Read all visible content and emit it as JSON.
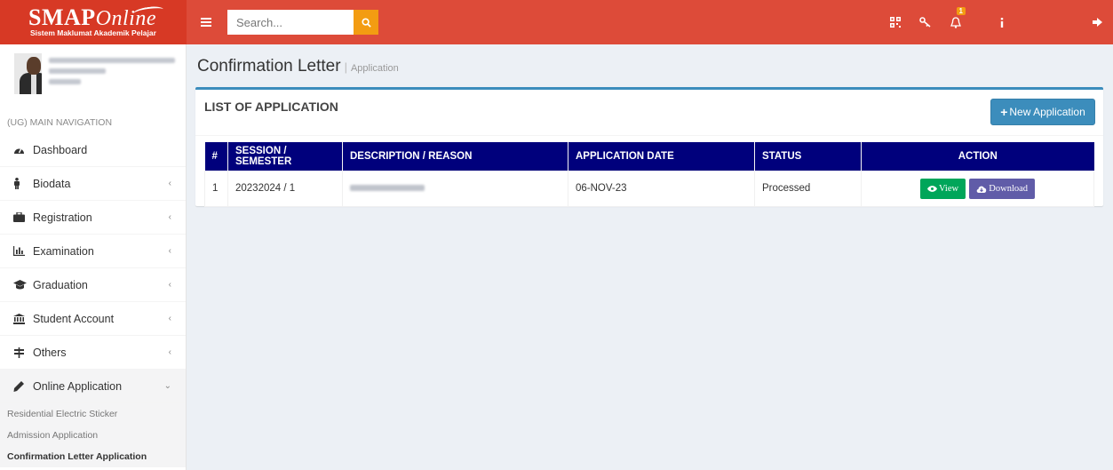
{
  "header": {
    "logo_text": "SMAP",
    "logo_script": "Online",
    "logo_subtitle": "Sistem Maklumat Akademik Pelajar",
    "search_placeholder": "Search...",
    "notification_count": "1"
  },
  "sidebar": {
    "nav_header": "(UG) MAIN NAVIGATION",
    "items": [
      {
        "label": "Dashboard",
        "icon": "dashboard-icon"
      },
      {
        "label": "Biodata",
        "icon": "male-icon"
      },
      {
        "label": "Registration",
        "icon": "briefcase-icon"
      },
      {
        "label": "Examination",
        "icon": "bar-chart-icon"
      },
      {
        "label": "Graduation",
        "icon": "graduation-cap-icon"
      },
      {
        "label": "Student Account",
        "icon": "bank-icon"
      },
      {
        "label": "Others",
        "icon": "signpost-icon"
      },
      {
        "label": "Online Application",
        "icon": "pencil-icon"
      }
    ],
    "submenu": [
      {
        "label": "Residential Electric Sticker"
      },
      {
        "label": "Admission Application"
      },
      {
        "label": "Confirmation Letter Application"
      }
    ]
  },
  "page": {
    "title": "Confirmation Letter",
    "separator": "|",
    "subtitle": "Application"
  },
  "box": {
    "title": "LIST OF APPLICATION",
    "new_button": "New Application",
    "columns": [
      "#",
      "SESSION / SEMESTER",
      "DESCRIPTION / REASON",
      "APPLICATION DATE",
      "STATUS",
      "ACTION"
    ],
    "rows": [
      {
        "no": "1",
        "session": "20232024 / 1",
        "date": "06-NOV-23",
        "status": "Processed",
        "view_label": "View",
        "download_label": "Download"
      }
    ]
  },
  "colors": {
    "header_red": "#dd4b39",
    "logo_red": "#d73925",
    "search_orange": "#f39c12",
    "primary_blue": "#3c8dbc",
    "table_header_navy": "#00007c",
    "view_green": "#00a65a",
    "download_purple": "#605ca8"
  }
}
